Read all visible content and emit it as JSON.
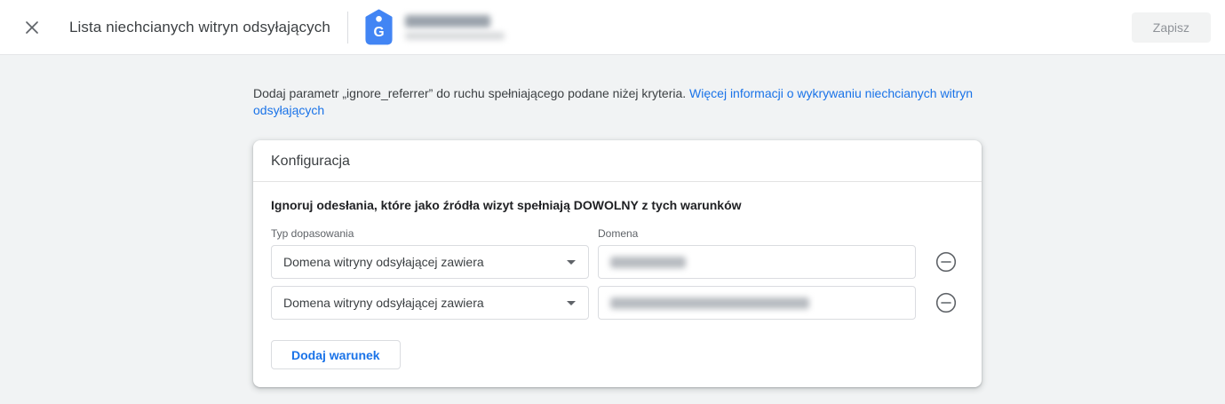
{
  "header": {
    "title": "Lista niechcianych witryn odsyłających",
    "save_button": "Zapisz"
  },
  "description": {
    "text": "Dodaj parametr „ignore_referrer” do ruchu spełniającego podane niżej kryteria. ",
    "link": "Więcej informacji o wykrywaniu niechcianych witryn odsyłających"
  },
  "card": {
    "title": "Konfiguracja",
    "condition_heading": "Ignoruj odesłania, które jako źródła wizyt spełniają DOWOLNY z tych warunków",
    "match_type_label": "Typ dopasowania",
    "domain_label": "Domena",
    "rows": [
      {
        "match_type": "Domena witryny odsyłającej zawiera"
      },
      {
        "match_type": "Domena witryny odsyłającej zawiera"
      }
    ],
    "add_condition_button": "Dodaj warunek"
  },
  "icons": {
    "close": "close-icon",
    "property_tag": "analytics-property-tag-icon",
    "dropdown_arrow": "chevron-down-icon",
    "remove": "remove-circle-icon",
    "tag_letter": "G"
  },
  "colors": {
    "accent_blue": "#1a73e8",
    "property_icon_blue": "#4285f4",
    "page_background": "#f1f3f4",
    "border_gray": "#dadce0",
    "text_primary": "#3c4043",
    "text_secondary": "#5f6368",
    "disabled_button_bg": "#f2f3f3",
    "disabled_button_text": "#8f9398"
  }
}
